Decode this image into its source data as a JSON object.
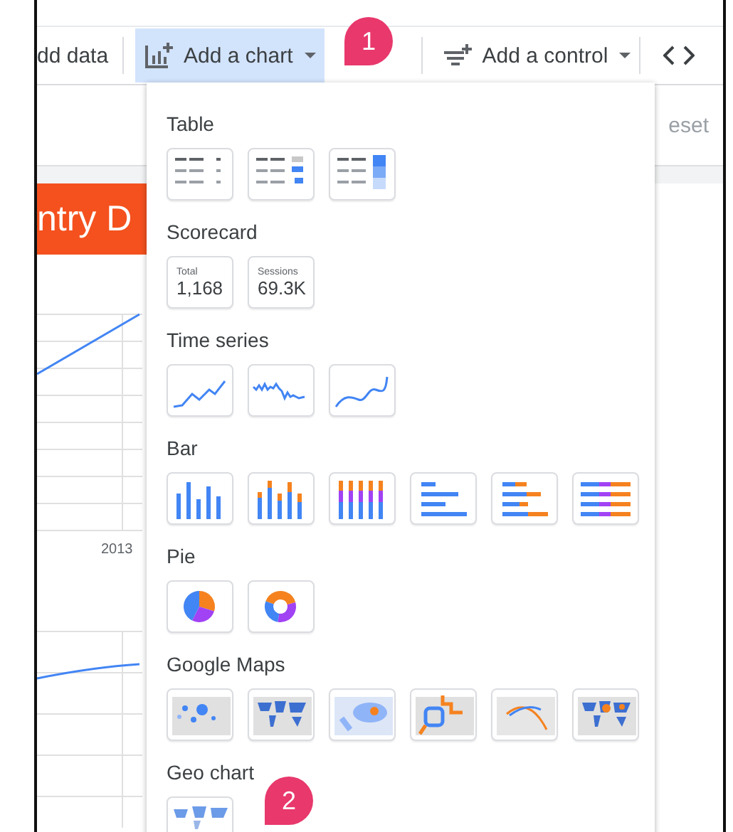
{
  "toolbar": {
    "add_data": "dd data",
    "add_chart": {
      "label": "Add a chart",
      "selected": true
    },
    "add_control": {
      "label": "Add a control",
      "selected": false
    }
  },
  "header": {
    "reset": "eset"
  },
  "canvas": {
    "title": "ntry D",
    "axis_label": "2013"
  },
  "chart_menu": {
    "sections": [
      {
        "title": "Table",
        "charts": [
          {
            "kind": "table"
          },
          {
            "kind": "table-bars"
          },
          {
            "kind": "table-heatmap"
          }
        ]
      },
      {
        "title": "Scorecard",
        "charts": [
          {
            "kind": "scorecard",
            "label": "Total",
            "value": "1,168"
          },
          {
            "kind": "scorecard",
            "label": "Sessions",
            "value": "69.3K"
          }
        ]
      },
      {
        "title": "Time series",
        "charts": [
          {
            "kind": "line"
          },
          {
            "kind": "sparkline"
          },
          {
            "kind": "smooth-line"
          }
        ]
      },
      {
        "title": "Bar",
        "charts": [
          {
            "kind": "column"
          },
          {
            "kind": "stacked-column"
          },
          {
            "kind": "full-stacked-column"
          },
          {
            "kind": "bar"
          },
          {
            "kind": "stacked-bar"
          },
          {
            "kind": "full-stacked-bar"
          }
        ]
      },
      {
        "title": "Pie",
        "charts": [
          {
            "kind": "pie"
          },
          {
            "kind": "donut"
          }
        ]
      },
      {
        "title": "Google Maps",
        "charts": [
          {
            "kind": "bubble-map"
          },
          {
            "kind": "filled-map"
          },
          {
            "kind": "heatmap-map"
          },
          {
            "kind": "line-map"
          },
          {
            "kind": "arc-map"
          },
          {
            "kind": "combo-map"
          }
        ]
      },
      {
        "title": "Geo chart",
        "charts": [
          {
            "kind": "geo"
          }
        ]
      }
    ]
  },
  "callouts": [
    {
      "label": "1"
    },
    {
      "label": "2"
    }
  ]
}
